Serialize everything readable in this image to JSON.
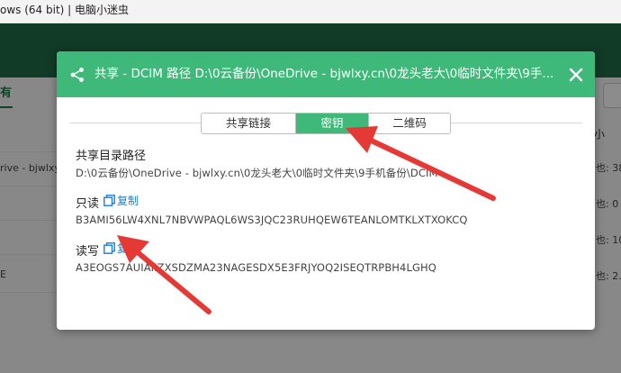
{
  "window": {
    "title": "ows (64 bit) | 电脑小迷虫"
  },
  "background": {
    "tab_label": "有",
    "rows": [
      "",
      "rive - bjwlxy",
      "",
      "",
      "E"
    ],
    "column_header": "小",
    "cells": [
      "也: 38",
      "也: 0",
      "也: 10",
      "也: 2."
    ]
  },
  "modal": {
    "title": "共享 - DCIM 路径 D:\\0云备份\\OneDrive - bjwlxy.cn\\0龙头老大\\0临时文件夹\\9手...",
    "tabs": [
      {
        "label": "共享链接",
        "active": false
      },
      {
        "label": "密钥",
        "active": true
      },
      {
        "label": "二维码",
        "active": false
      }
    ],
    "path_section": {
      "label": "共享目录路径",
      "value": "D:\\0云备份\\OneDrive - bjwlxy.cn\\0龙头老大\\0临时文件夹\\9手机备份\\DCIM"
    },
    "readonly_section": {
      "label": "只读",
      "copy_label": "复制",
      "value": "B3AMI56LW4XNL7NBVWPAQL6WS3JQC23RUHQEW6TEANLOMTKLXTXOKCQ"
    },
    "readwrite_section": {
      "label": "读写",
      "copy_label": "复制",
      "value": "A3EOGS7AUIAIIZXSDZMA23NAGESDX5E3FRJYOQ2ISEQTRPBH4LGHQ"
    }
  },
  "colors": {
    "header_green": "#3fb97a",
    "app_header": "#1f6b47",
    "link_blue": "#1a7fd0",
    "arrow_red": "#e53935"
  },
  "icons": [
    "share-icon",
    "close-icon",
    "copy-icon"
  ]
}
